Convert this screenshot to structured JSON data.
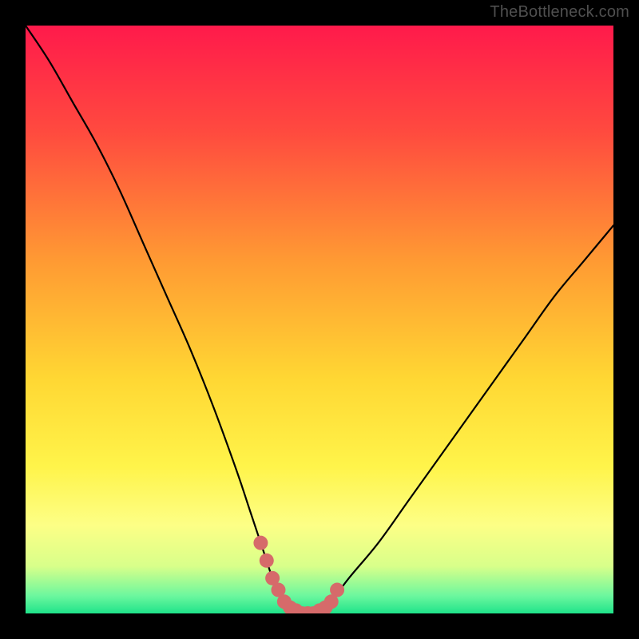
{
  "watermark": {
    "text": "TheBottleneck.com"
  },
  "colors": {
    "frame": "#000000",
    "curve": "#000000",
    "points": "#d66a6a",
    "gradient_stops": [
      {
        "pct": 0,
        "color": "#ff1a4b"
      },
      {
        "pct": 18,
        "color": "#ff4a3f"
      },
      {
        "pct": 40,
        "color": "#ff9a33"
      },
      {
        "pct": 60,
        "color": "#ffd733"
      },
      {
        "pct": 75,
        "color": "#fff44a"
      },
      {
        "pct": 85,
        "color": "#fdff86"
      },
      {
        "pct": 92,
        "color": "#d8ff8a"
      },
      {
        "pct": 97,
        "color": "#6cf79e"
      },
      {
        "pct": 100,
        "color": "#1fe38a"
      }
    ]
  },
  "chart_data": {
    "type": "line",
    "title": "",
    "xlabel": "",
    "ylabel": "",
    "xlim": [
      0,
      100
    ],
    "ylim": [
      0,
      100
    ],
    "grid": false,
    "legend": false,
    "series": [
      {
        "name": "bottleneck-curve",
        "x": [
          0,
          4,
          8,
          12,
          16,
          20,
          24,
          28,
          32,
          36,
          38,
          40,
          41,
          42,
          43,
          44,
          45,
          46,
          47,
          48,
          49,
          50,
          51,
          52,
          55,
          60,
          65,
          70,
          75,
          80,
          85,
          90,
          95,
          100
        ],
        "values": [
          100,
          94,
          87,
          80,
          72,
          63,
          54,
          45,
          35,
          24,
          18,
          12,
          9,
          6,
          4,
          2,
          1,
          0.5,
          0,
          0,
          0,
          0.5,
          1,
          2,
          6,
          12,
          19,
          26,
          33,
          40,
          47,
          54,
          60,
          66
        ]
      }
    ],
    "highlight_points": {
      "name": "valley-points",
      "x": [
        40,
        41,
        42,
        43,
        44,
        45,
        46,
        47,
        48,
        49,
        50,
        51,
        52,
        53
      ],
      "values": [
        12,
        9,
        6,
        4,
        2,
        1,
        0.5,
        0,
        0,
        0,
        0.5,
        1,
        2,
        4
      ]
    }
  }
}
